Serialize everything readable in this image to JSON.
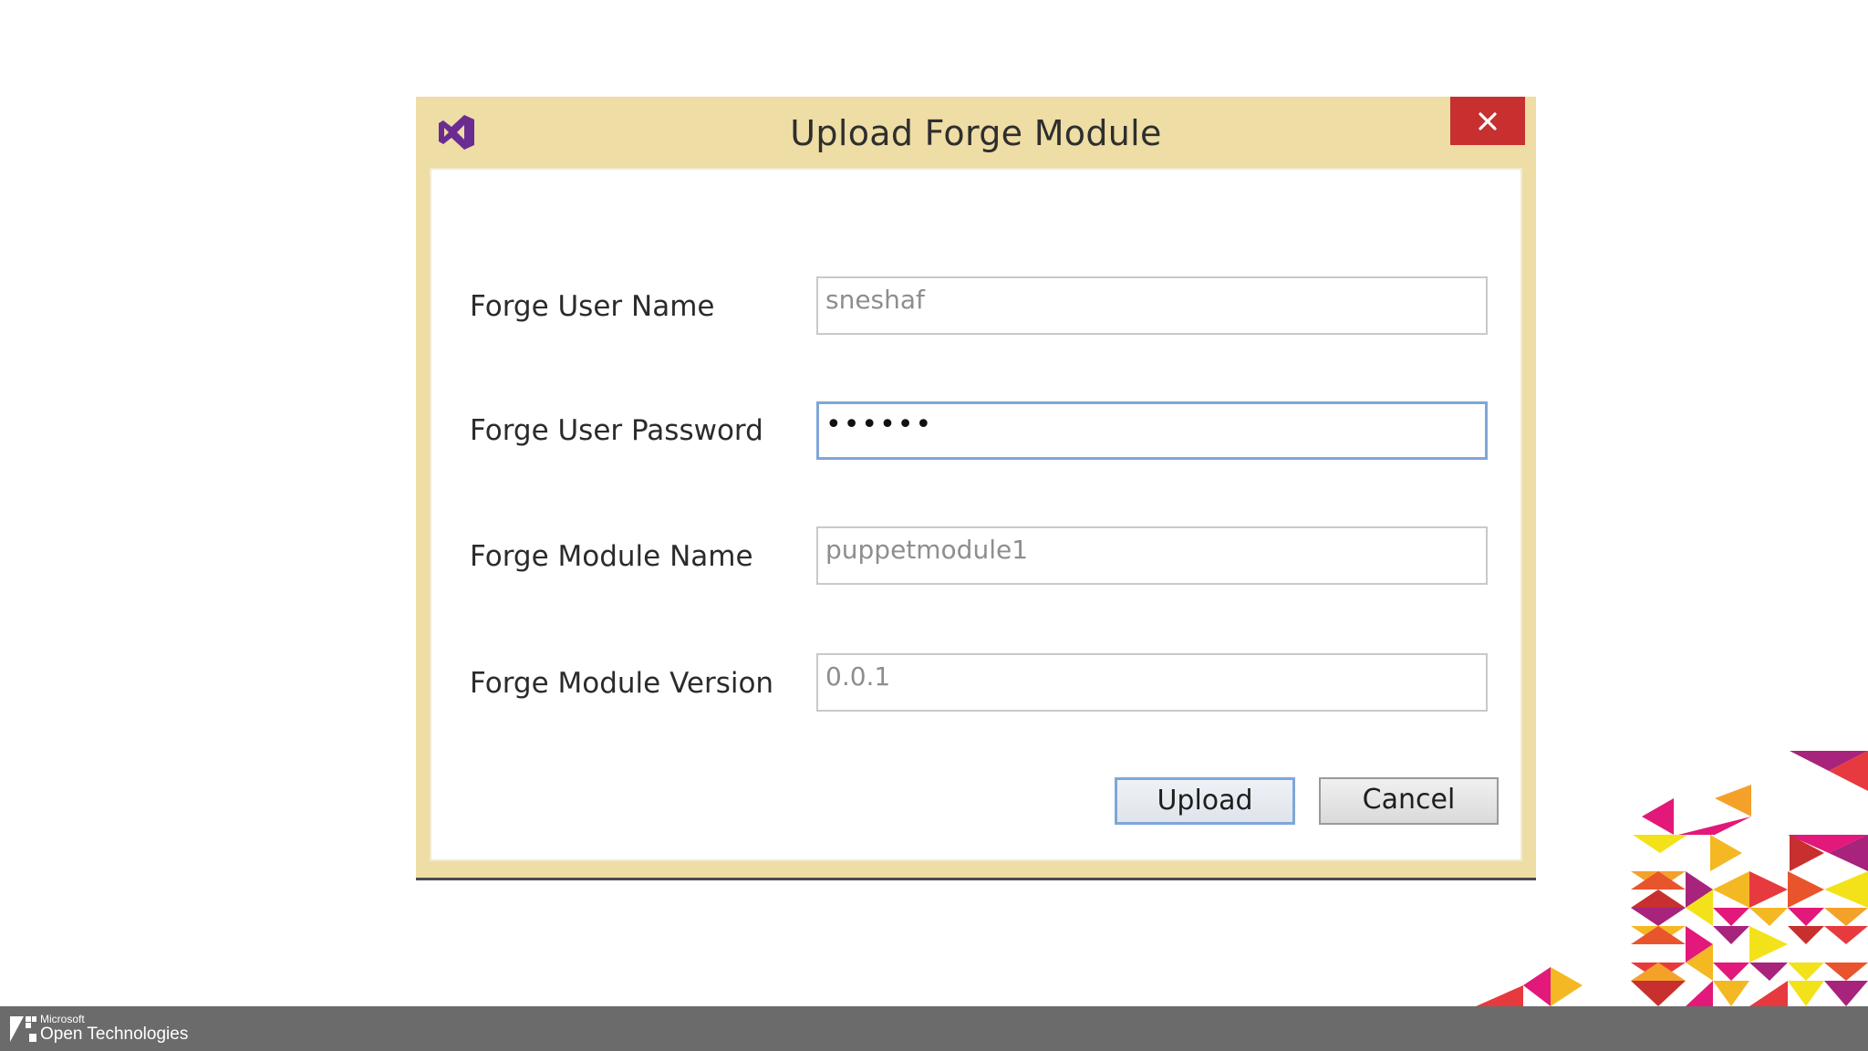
{
  "dialog": {
    "title": "Upload Forge Module",
    "close_icon": "close-icon",
    "app_icon": "visual-studio-icon",
    "fields": [
      {
        "label": "Forge User Name",
        "value": "sneshaf",
        "type": "text"
      },
      {
        "label": "Forge User Password",
        "value": "••••••",
        "type": "password"
      },
      {
        "label": "Forge Module Name",
        "value": "puppetmodule1",
        "type": "text"
      },
      {
        "label": "Forge Module Version",
        "value": "0.0.1",
        "type": "text"
      }
    ],
    "upload_label": "Upload",
    "cancel_label": "Cancel"
  },
  "footer": {
    "brand_small": "Microsoft",
    "brand_large": "Open Technologies"
  },
  "colors": {
    "title_bar": "#eedda4",
    "close_button": "#c7302e",
    "focus_border": "#7fa6d8",
    "footer_bar": "#6b6b6b"
  }
}
